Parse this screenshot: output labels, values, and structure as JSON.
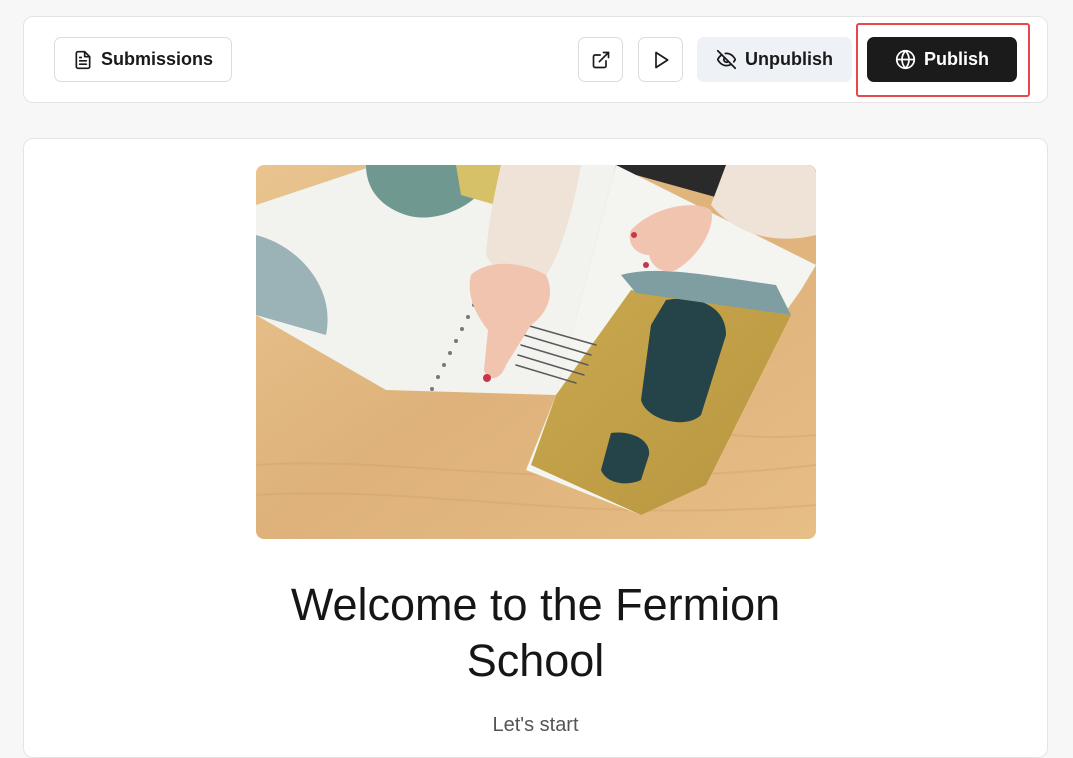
{
  "toolbar": {
    "submissions_label": "Submissions",
    "unpublish_label": "Unpublish",
    "publish_label": "Publish",
    "icons": {
      "submissions": "document-icon",
      "external": "external-link-icon",
      "preview": "play-icon",
      "unpublish": "eye-off-icon",
      "publish": "globe-icon"
    }
  },
  "content": {
    "title_line1": "Welcome to the Fermion",
    "title_line2": "School",
    "subtitle": "Let's start"
  },
  "colors": {
    "publish_bg": "#1b1b1b",
    "unpublish_bg": "#eef2f7",
    "highlight": "#e5484d"
  }
}
